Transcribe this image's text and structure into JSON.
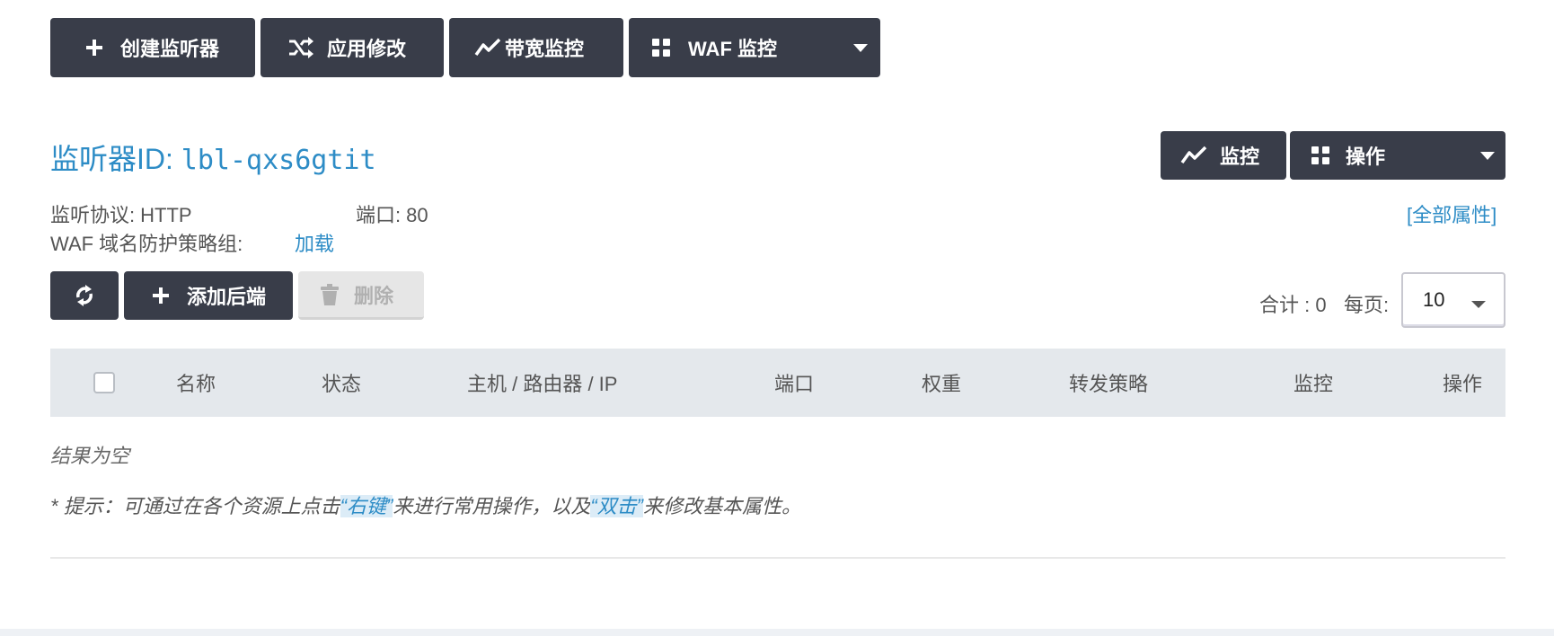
{
  "toolbar": {
    "create_listener": "创建监听器",
    "apply_changes": "应用修改",
    "bandwidth_monitor": "带宽监控",
    "waf_monitor": "WAF 监控"
  },
  "listener": {
    "title_prefix": "监听器ID: ",
    "id": "lbl-qxs6gtit",
    "monitor_button": "监控",
    "operations_button": "操作",
    "protocol_label": "监听协议:",
    "protocol_value": "HTTP",
    "port_label": "端口:",
    "port_value": "80",
    "waf_label": "WAF 域名防护策略组:",
    "waf_link": "加载",
    "all_properties": "[全部属性]"
  },
  "backend_toolbar": {
    "add_backend": "添加后端",
    "delete": "删除"
  },
  "pager": {
    "total_text": "合计 : 0",
    "per_page_label": "每页:",
    "per_page_value": "10"
  },
  "table": {
    "columns": [
      "名称",
      "状态",
      "主机 / 路由器 / IP",
      "端口",
      "权重",
      "转发策略",
      "监控",
      "操作"
    ],
    "empty_text": "结果为空"
  },
  "hint": {
    "prefix": "* 提示：可通过在各个资源上点击",
    "right_click": "“右键”",
    "middle": "来进行常用操作，以及",
    "double_click": "“双击”",
    "suffix": "来修改基本属性。"
  },
  "colors": {
    "button_dark": "#393d49",
    "link_blue": "#2d8cc6",
    "table_header_bg": "#e4e8ec"
  },
  "icons": [
    "plus-icon",
    "shuffle-icon",
    "trend-icon",
    "grid-icon",
    "refresh-icon",
    "trash-icon"
  ]
}
